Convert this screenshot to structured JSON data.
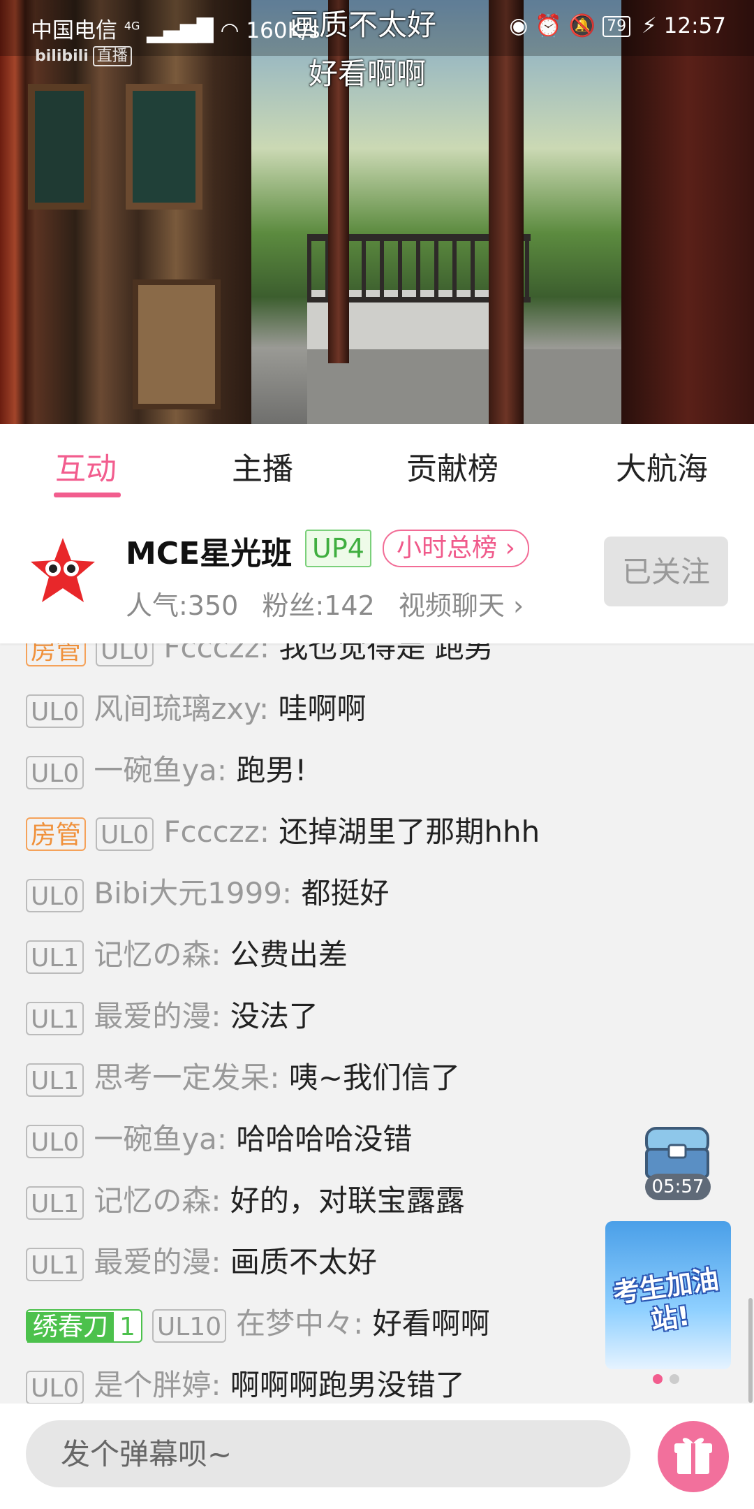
{
  "status_bar": {
    "carrier": "中国电信",
    "network": "4G",
    "speed": "160K/s",
    "battery": "79",
    "time": "12:57"
  },
  "player": {
    "watermark": "bilibili",
    "watermark_tag": "直播",
    "danmaku": [
      "画质不太好",
      "好看啊啊"
    ]
  },
  "tabs": [
    {
      "label": "互动",
      "active": true
    },
    {
      "label": "主播",
      "active": false
    },
    {
      "label": "贡献榜",
      "active": false
    },
    {
      "label": "大航海",
      "active": false
    }
  ],
  "anchor": {
    "name": "MCE星光班",
    "up_level": "UP4",
    "rank_label": "小时总榜 ›",
    "popularity": "人气:350",
    "fans": "粉丝:142",
    "video_chat": "视频聊天 ›",
    "follow_label": "已关注"
  },
  "chat": {
    "messages": [
      {
        "badges": [
          {
            "type": "admin",
            "label": "房管"
          },
          {
            "type": "level",
            "label": "UL0"
          }
        ],
        "user": "Fccczz",
        "text": "我也觉得是 跑男"
      },
      {
        "badges": [
          {
            "type": "level",
            "label": "UL0"
          }
        ],
        "user": "风间琉璃zxy",
        "text": "哇啊啊"
      },
      {
        "badges": [
          {
            "type": "level",
            "label": "UL0"
          }
        ],
        "user": "一碗鱼ya",
        "text": "跑男!"
      },
      {
        "badges": [
          {
            "type": "admin",
            "label": "房管"
          },
          {
            "type": "level",
            "label": "UL0"
          }
        ],
        "user": "Fccczz",
        "text": "还掉湖里了那期hhh"
      },
      {
        "badges": [
          {
            "type": "level",
            "label": "UL0"
          }
        ],
        "user": "Bibi大元1999",
        "text": "都挺好"
      },
      {
        "badges": [
          {
            "type": "level",
            "label": "UL1"
          }
        ],
        "user": "记忆の森",
        "text": "公费出差"
      },
      {
        "badges": [
          {
            "type": "level",
            "label": "UL1"
          }
        ],
        "user": "最爱的漫",
        "text": "没法了"
      },
      {
        "badges": [
          {
            "type": "level",
            "label": "UL1"
          }
        ],
        "user": "思考一定发呆",
        "text": "咦~我们信了"
      },
      {
        "badges": [
          {
            "type": "level",
            "label": "UL0"
          }
        ],
        "user": "一碗鱼ya",
        "text": "哈哈哈哈没错"
      },
      {
        "badges": [
          {
            "type": "level",
            "label": "UL1"
          }
        ],
        "user": "记忆の森",
        "text": "好的，对联宝露露"
      },
      {
        "badges": [
          {
            "type": "level",
            "label": "UL1"
          }
        ],
        "user": "最爱的漫",
        "text": "画质不太好"
      },
      {
        "badges": [
          {
            "type": "medal",
            "name": "绣春刀",
            "level": "1"
          },
          {
            "type": "level",
            "label": "UL10"
          }
        ],
        "user": "在梦中々",
        "text": "好看啊啊"
      },
      {
        "badges": [
          {
            "type": "level",
            "label": "UL0"
          }
        ],
        "user": "是个胖婷",
        "text": "啊啊啊跑男没错了"
      }
    ]
  },
  "widgets": {
    "chest_timer": "05:57",
    "banner_text": "考生加油站!",
    "banner_page": 1,
    "banner_pages": 2
  },
  "input": {
    "placeholder": "发个弹幕呗~"
  },
  "colors": {
    "accent": "#f25d8e",
    "admin": "#f0913b",
    "medal": "#4cc14c",
    "up_badge": "#3fae3f"
  }
}
